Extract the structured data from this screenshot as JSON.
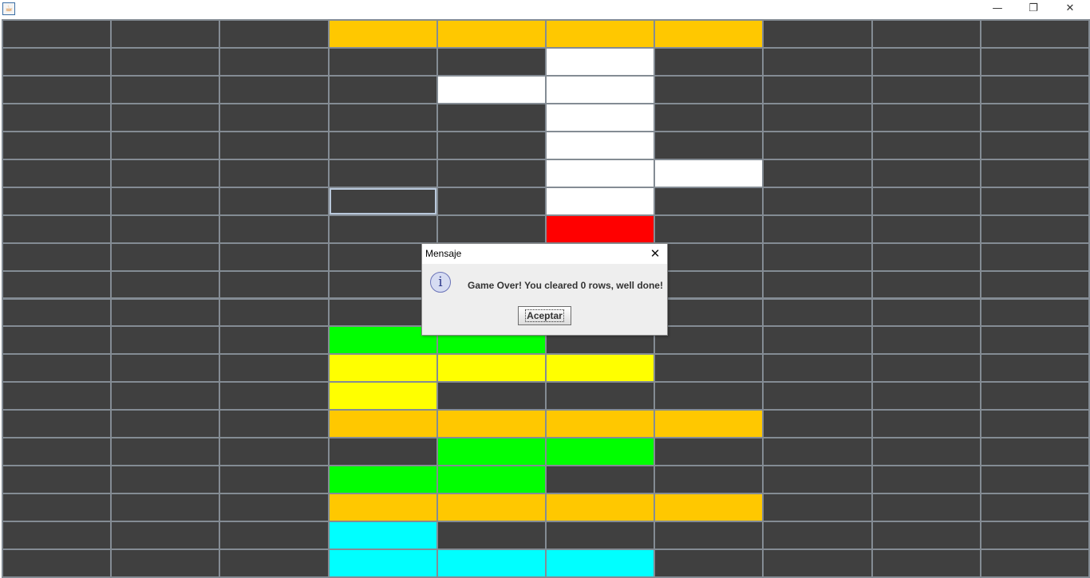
{
  "window": {
    "app_icon": "java-cup-icon",
    "controls": [
      "minimize-icon",
      "maximize-icon",
      "close-icon"
    ]
  },
  "board": {
    "columns": 10,
    "rows": 20,
    "empty_color": "#404040",
    "grid_color": "#848c94",
    "palette": {
      "O": "#ffc800",
      "W": "#ffffff",
      "R": "#ff0000",
      "G": "#00ff00",
      "Y": "#ffff00",
      "C": "#00ffff"
    },
    "grid": [
      "...OOOO...",
      ".....W....",
      "....WW....",
      ".....W....",
      ".....W....",
      ".....WW...",
      "...F.W....",
      ".....R....",
      "..........",
      "..........",
      "..........",
      "...GG.....",
      "...YYY....",
      "...Y......",
      "...OOOO...",
      "....GG....",
      "...GG.....",
      "...OOOO...",
      "...C......",
      "...CCC...."
    ]
  },
  "dialog": {
    "title": "Mensaje",
    "icon": "information-icon",
    "message": "Game Over! You cleared 0 rows, well done!",
    "ok_label": "Aceptar"
  }
}
